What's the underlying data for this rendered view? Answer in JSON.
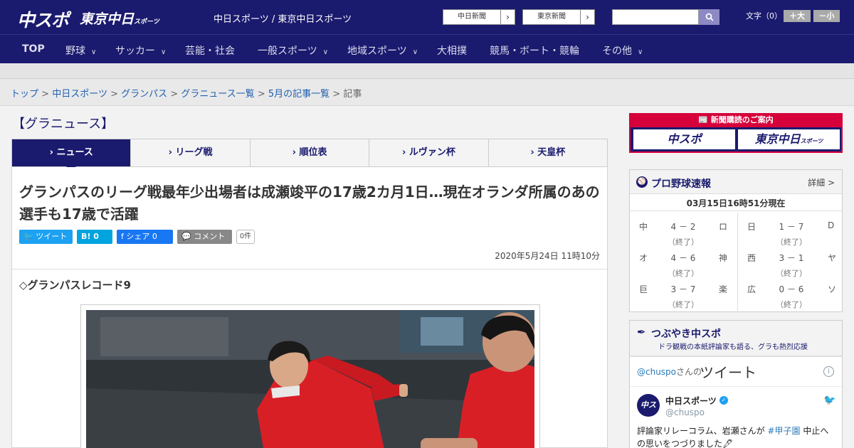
{
  "header": {
    "logo_chuspo": "中スポ",
    "logo_tokyo": "東京中日",
    "logo_tokyo_small": "スポーツ",
    "site_title": "中日スポーツ / 東京中日スポーツ",
    "paper_links": [
      {
        "label": "中日新聞"
      },
      {
        "label": "東京新聞"
      }
    ],
    "search": {
      "placeholder": "",
      "icon": "search-icon"
    },
    "font_size_label": "文字（0）",
    "font_larger": "＋大",
    "font_smaller": "－小"
  },
  "nav": {
    "items": [
      {
        "label": "TOP",
        "has_menu": false
      },
      {
        "label": "野球",
        "has_menu": true
      },
      {
        "label": "サッカー",
        "has_menu": true
      },
      {
        "label": "芸能・社会",
        "has_menu": false
      },
      {
        "label": "一般スポーツ",
        "has_menu": true
      },
      {
        "label": "地域スポーツ",
        "has_menu": true
      },
      {
        "label": "大相撲",
        "has_menu": false
      },
      {
        "label": "競馬・ボート・競輪",
        "has_menu": false
      },
      {
        "label": "その他",
        "has_menu": true
      }
    ]
  },
  "breadcrumb": {
    "items": [
      "トップ",
      "中日スポーツ",
      "グランパス",
      "グラニュース一覧",
      "5月の記事一覧"
    ],
    "current": "記事",
    "separator": ">"
  },
  "section": {
    "heading": "【グラニュース】",
    "tabs": [
      {
        "label": "ニュース",
        "active": true
      },
      {
        "label": "リーグ戦",
        "active": false
      },
      {
        "label": "順位表",
        "active": false
      },
      {
        "label": "ルヴァン杯",
        "active": false
      },
      {
        "label": "天皇杯",
        "active": false
      }
    ]
  },
  "article": {
    "headline": "グランパスのリーグ戦最年少出場者は成瀬竣平の17歳2カ月1日…現在オランダ所属のあの選手も17歳で活躍",
    "share": {
      "tweet": "ツイート",
      "hatena": "B! 0",
      "facebook": "シェア 0",
      "comment": "コメント",
      "comment_count": "0件"
    },
    "date": "2020年5月24日 11時10分",
    "subhead": "◇グランパスレコード9"
  },
  "sidebar": {
    "subscribe": {
      "heading": "新聞購読のご案内",
      "logos": [
        "中スポ",
        "東京中日"
      ],
      "logo_small": "スポーツ"
    },
    "baseball": {
      "title": "プロ野球速報",
      "more": "詳細 >",
      "time": "03月15日16時51分現在",
      "games": [
        {
          "home": "中",
          "score": "4 － 2",
          "away": "ロ",
          "status": "（終了）"
        },
        {
          "home": "日",
          "score": "1 － 7",
          "away": "D",
          "status": "（終了）"
        },
        {
          "home": "オ",
          "score": "4 － 6",
          "away": "神",
          "status": "（終了）"
        },
        {
          "home": "西",
          "score": "3 － 1",
          "away": "ヤ",
          "status": "（終了）"
        },
        {
          "home": "巨",
          "score": "3 － 7",
          "away": "楽",
          "status": "（終了）"
        },
        {
          "home": "広",
          "score": "0 － 6",
          "away": "ソ",
          "status": "（終了）"
        }
      ]
    },
    "tsubuyaki": {
      "title": "つぶやき中スポ",
      "subtitle": "ドラ観戦の本紙評論家も語る、グラも熱烈応援",
      "handle": "@chuspo",
      "handle_suffix": "さんの",
      "tweet_label": "ツイート",
      "account_name": "中日スポーツ",
      "account_handle": "@chuspo",
      "tweet_text_before": "評論家リレーコラム、岩瀬さんが ",
      "tweet_hashtag": "#甲子園",
      "tweet_text_after": " 中止への思いをつづりました🖋"
    }
  },
  "colors": {
    "brand_navy": "#1a1a6e",
    "accent_red": "#d6003b",
    "link_blue": "#2060b0",
    "twitter_blue": "#1da1f2",
    "facebook_blue": "#1877f2",
    "hatena_blue": "#00a4de"
  }
}
